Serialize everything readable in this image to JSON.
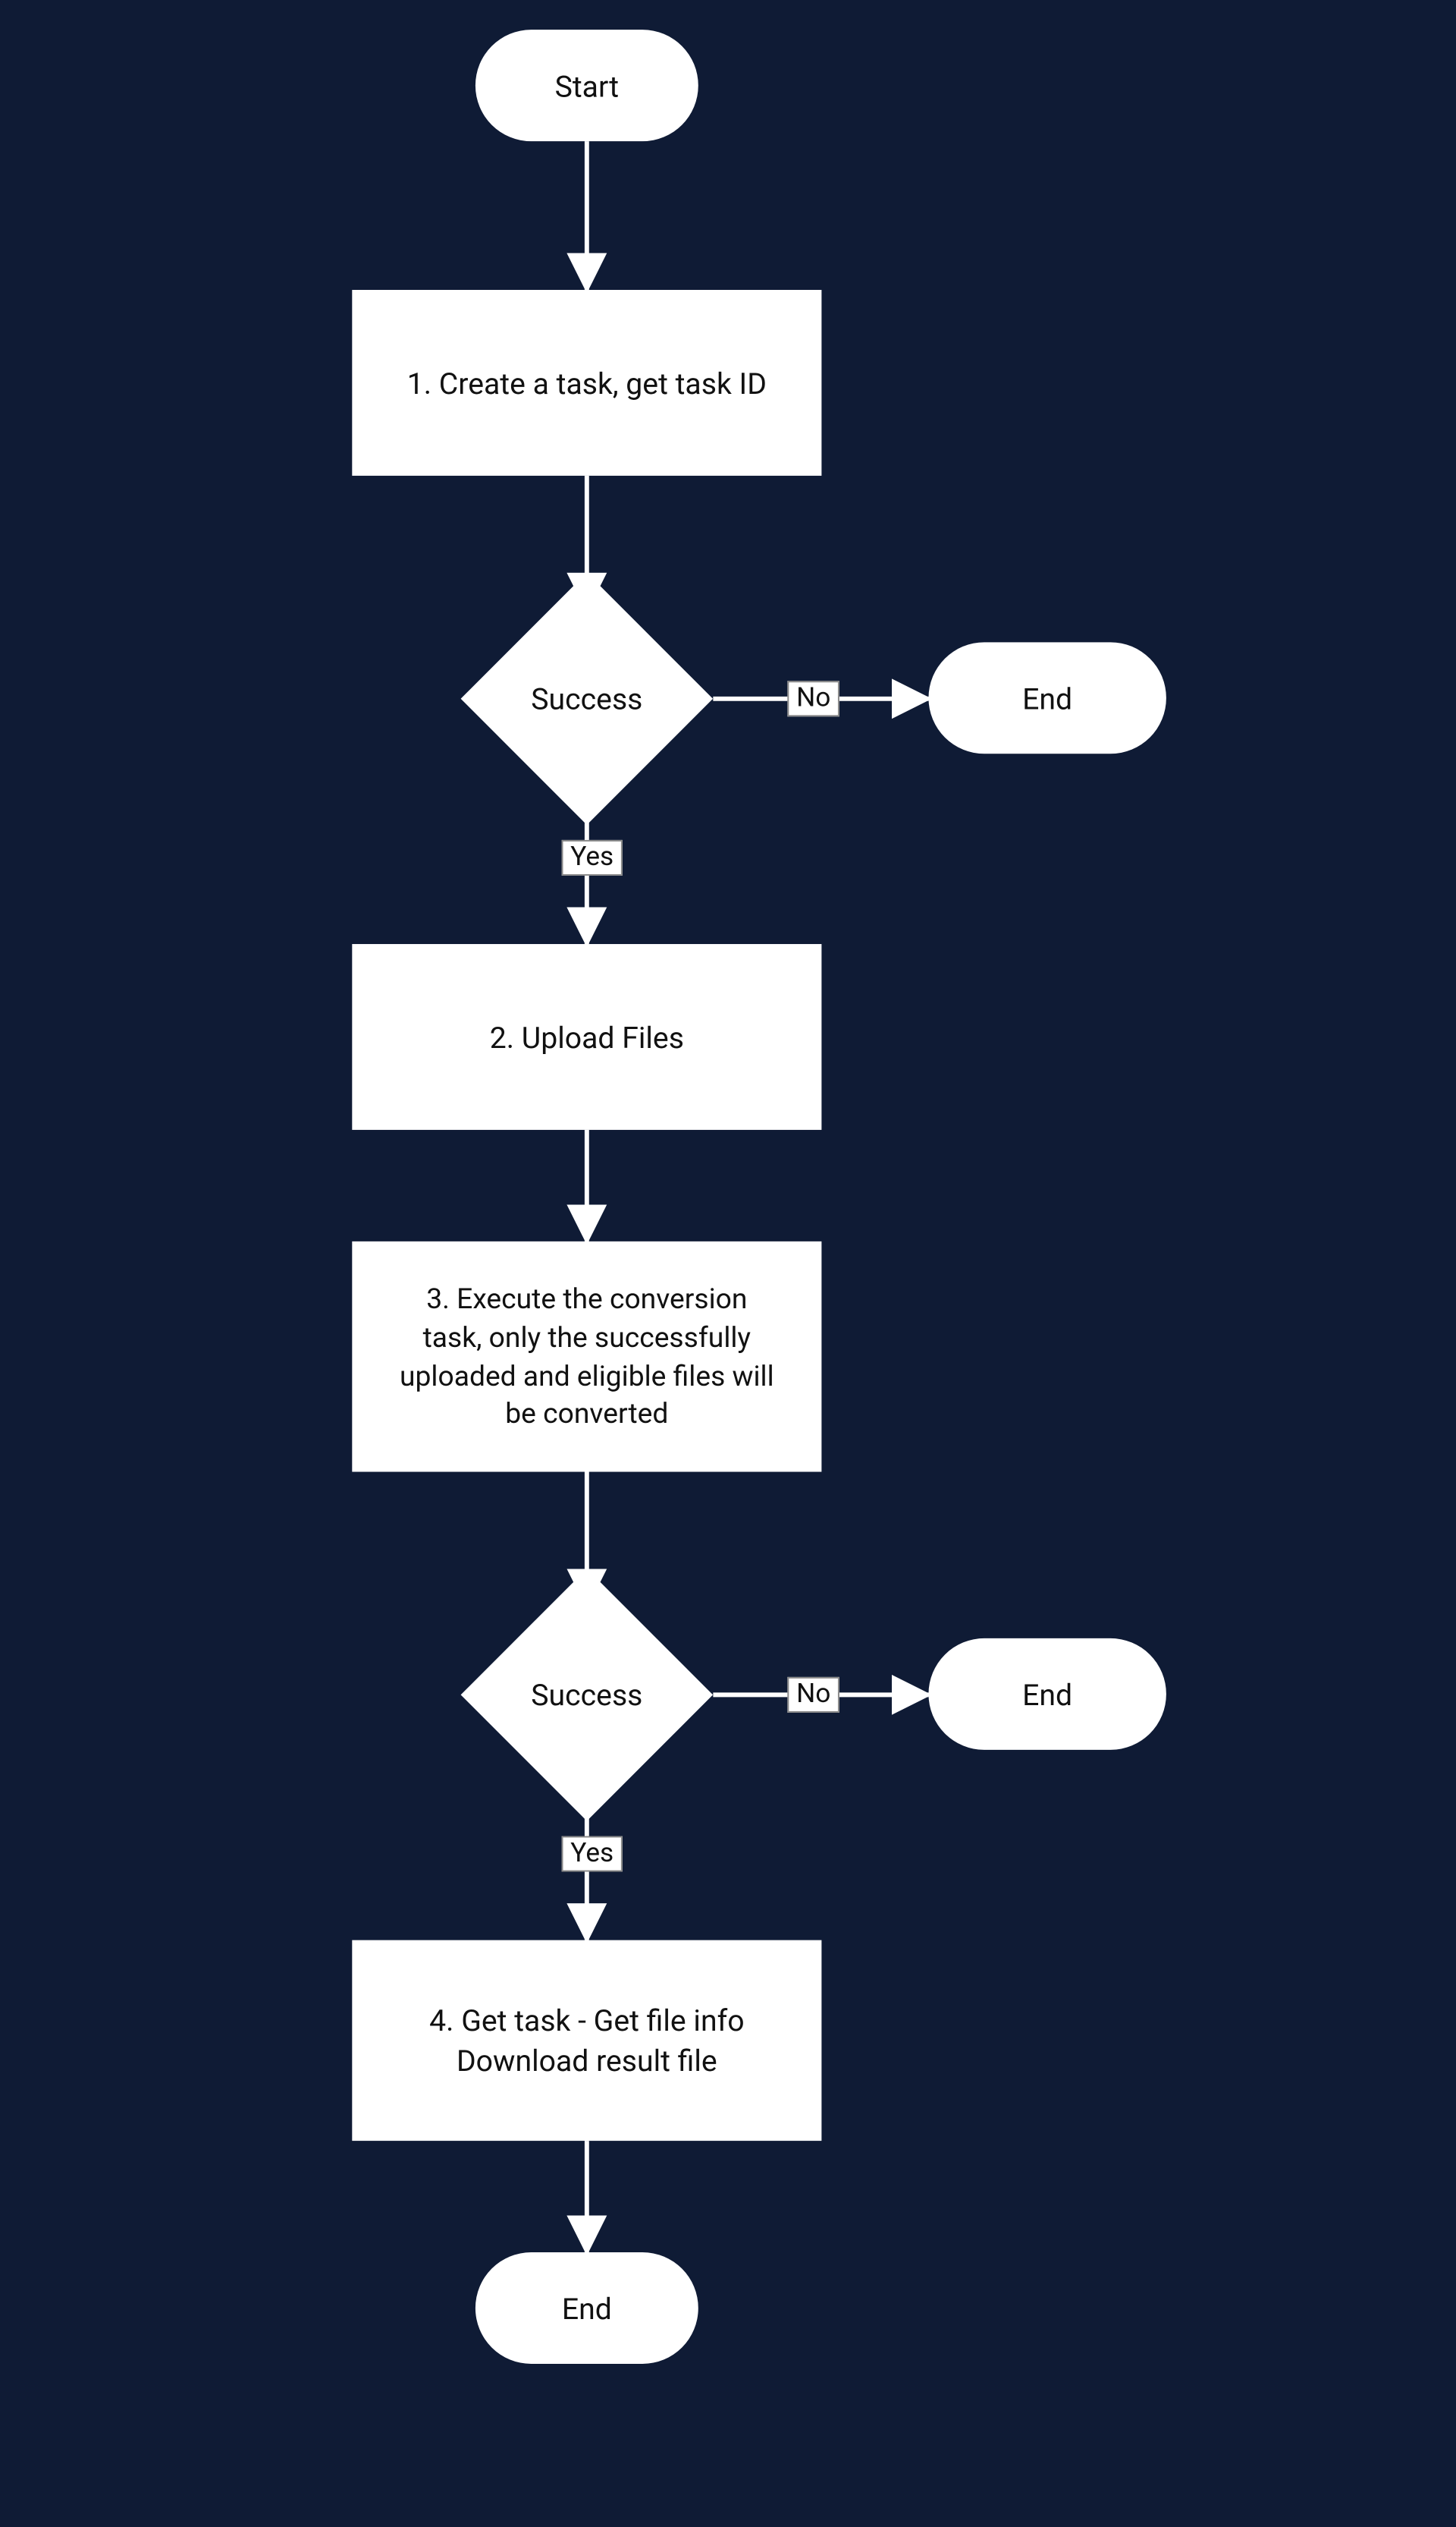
{
  "flowchart": {
    "nodes": {
      "start": {
        "label": "Start"
      },
      "step1": {
        "label": "1. Create a task, get task ID"
      },
      "decision1": {
        "label": "Success"
      },
      "end1": {
        "label": "End"
      },
      "step2": {
        "label": "2. Upload Files"
      },
      "step3": {
        "label": "3. Execute the conversion task, only the successfully uploaded and eligible files will be converted"
      },
      "decision2": {
        "label": "Success"
      },
      "end2": {
        "label": "End"
      },
      "step4": {
        "label": "4. Get task - Get file info Download result file"
      },
      "end3": {
        "label": "End"
      }
    },
    "edges": {
      "d1_yes": "Yes",
      "d1_no": "No",
      "d2_yes": "Yes",
      "d2_no": "No"
    }
  }
}
